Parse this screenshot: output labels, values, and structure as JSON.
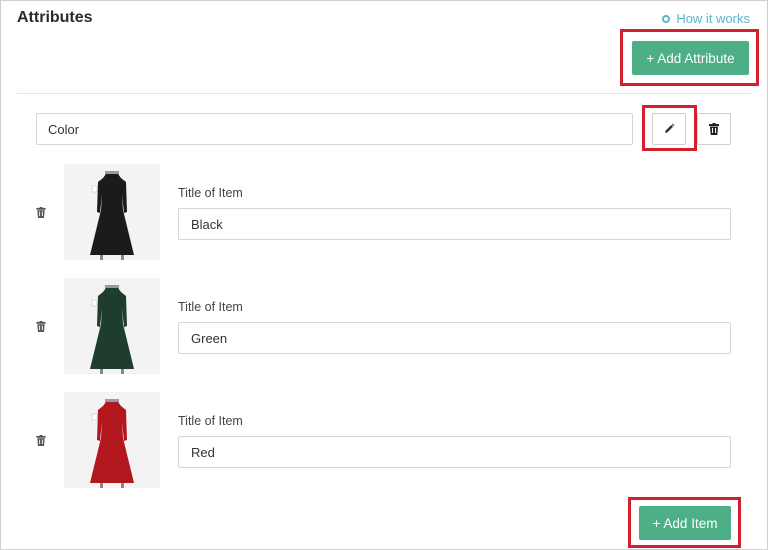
{
  "header": {
    "title": "Attributes",
    "help_link": "How it works"
  },
  "actions": {
    "add_attribute_label": "+ Add Attribute",
    "add_item_label": "+ Add Item"
  },
  "attribute": {
    "name_value": "Color"
  },
  "items": [
    {
      "label": "Title of Item",
      "value": "Black",
      "dress_color": "#1b1b1b"
    },
    {
      "label": "Title of Item",
      "value": "Green",
      "dress_color": "#1f3d2e"
    },
    {
      "label": "Title of Item",
      "value": "Red",
      "dress_color": "#b3171e"
    }
  ],
  "colors": {
    "accent_green": "#4caf85",
    "link_blue": "#5ab5c9",
    "highlight_red": "#d3202f"
  },
  "icons": [
    "help-circle-icon",
    "pencil-icon",
    "trash-icon",
    "dress-image"
  ]
}
